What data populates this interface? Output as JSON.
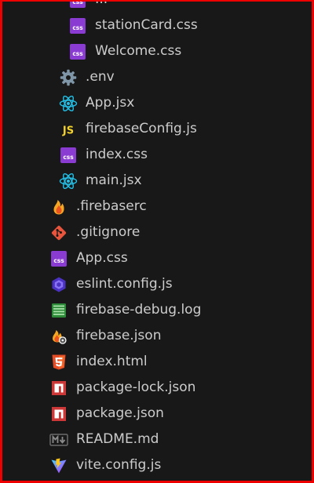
{
  "explorer": {
    "items": [
      {
        "label": "...",
        "icon": "css-file-icon",
        "level": 3
      },
      {
        "label": "stationCard.css",
        "icon": "css-file-icon",
        "level": 3
      },
      {
        "label": "Welcome.css",
        "icon": "css-file-icon",
        "level": 3
      },
      {
        "label": ".env",
        "icon": "gear-icon",
        "level": 2
      },
      {
        "label": "App.jsx",
        "icon": "react-icon",
        "level": 2
      },
      {
        "label": "firebaseConfig.js",
        "icon": "javascript-icon",
        "level": 2
      },
      {
        "label": "index.css",
        "icon": "css-file-icon",
        "level": 2
      },
      {
        "label": "main.jsx",
        "icon": "react-icon",
        "level": 2
      },
      {
        "label": ".firebaserc",
        "icon": "firebase-flame-icon",
        "level": 1
      },
      {
        "label": ".gitignore",
        "icon": "git-icon",
        "level": 1
      },
      {
        "label": "App.css",
        "icon": "css-file-icon",
        "level": 1
      },
      {
        "label": "eslint.config.js",
        "icon": "eslint-icon",
        "level": 1
      },
      {
        "label": "firebase-debug.log",
        "icon": "log-file-icon",
        "level": 1
      },
      {
        "label": "firebase.json",
        "icon": "firebase-json-icon",
        "level": 1
      },
      {
        "label": "index.html",
        "icon": "html5-icon",
        "level": 1
      },
      {
        "label": "package-lock.json",
        "icon": "npm-icon",
        "level": 1
      },
      {
        "label": "package.json",
        "icon": "npm-icon",
        "level": 1
      },
      {
        "label": "README.md",
        "icon": "markdown-icon",
        "level": 1
      },
      {
        "label": "vite.config.js",
        "icon": "vite-icon",
        "level": 1
      }
    ]
  },
  "colors": {
    "background": "#181818",
    "border": "#ee0000",
    "text": "#cccccc",
    "css": "#8a3bd1",
    "react": "#23bfe6",
    "javascript": "#f2d22b",
    "firebase": "#f5a623",
    "git": "#e8543c",
    "html": "#e44d26",
    "npm": "#cb3837",
    "log": "#3fa845",
    "eslint": "#7b5cf5"
  }
}
